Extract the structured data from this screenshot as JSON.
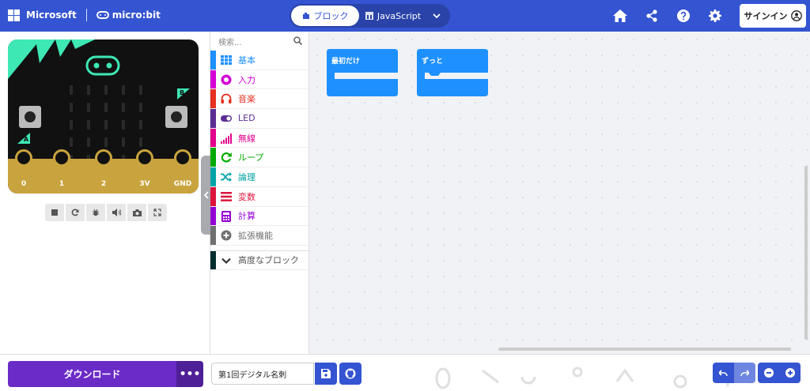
{
  "header": {
    "brand_microsoft": "Microsoft",
    "brand_microbit": "micro:bit",
    "tab_blocks": "ブロック",
    "tab_javascript": "JavaScript",
    "signin_label": "サインイン",
    "accent_color": "#3454d1"
  },
  "simulator": {
    "pin_labels": [
      "0",
      "1",
      "2",
      "3V",
      "GND"
    ],
    "button_a": "A",
    "button_b": "B"
  },
  "toolbox": {
    "search_placeholder": "検索...",
    "categories": [
      {
        "label": "基本",
        "color": "#1e90ff",
        "icon": "grid-icon"
      },
      {
        "label": "入力",
        "color": "#d400d4",
        "icon": "input-icon"
      },
      {
        "label": "音楽",
        "color": "#e63022",
        "icon": "headphones-icon"
      },
      {
        "label": "LED",
        "color": "#5c2d91",
        "icon": "toggle-icon"
      },
      {
        "label": "無線",
        "color": "#e3008c",
        "icon": "signal-icon"
      },
      {
        "label": "ループ",
        "color": "#00aa00",
        "icon": "loop-icon"
      },
      {
        "label": "論理",
        "color": "#00a4a6",
        "icon": "shuffle-icon"
      },
      {
        "label": "変数",
        "color": "#dc143c",
        "icon": "list-icon"
      },
      {
        "label": "計算",
        "color": "#9400d3",
        "icon": "calculator-icon"
      },
      {
        "label": "拡張機能",
        "color": "#707070",
        "icon": "plus-circle-icon"
      }
    ],
    "advanced": {
      "label": "高度なブロック",
      "color": "#042e2e",
      "icon": "chevron-down-icon"
    }
  },
  "workspace": {
    "blocks": [
      {
        "label": "最初だけ",
        "color": "#1e90ff"
      },
      {
        "label": "ずっと",
        "color": "#1e90ff"
      }
    ]
  },
  "footer": {
    "download_label": "ダウンロード",
    "more_label": "•••",
    "project_name": "第1回デジタル名刺"
  }
}
